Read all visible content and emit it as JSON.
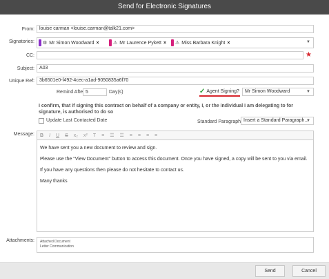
{
  "dialog": {
    "title": "Send for Electronic Signatures"
  },
  "from": {
    "label": "From:",
    "value": "louise carman <louise.carman@talk21.com>"
  },
  "signatories": {
    "label": "Signatories:",
    "items": [
      {
        "name": "Mr Simon Woodward",
        "color": "#8b2fc9",
        "icon": "gear-icon",
        "remove": "×"
      },
      {
        "name": "Mr Laurence Pykett",
        "color": "#d61f7c",
        "icon": "warning-icon",
        "remove": "×"
      },
      {
        "name": "Miss Barbara Knight",
        "color": "#d61f7c",
        "icon": "warning-icon",
        "remove": "×"
      }
    ]
  },
  "cc": {
    "label": "CC:",
    "value": ""
  },
  "subject": {
    "label": "Subject:",
    "value": "A03"
  },
  "unique_ref": {
    "label": "Unique Ref:",
    "value": "3b6501e0-f492-4cec-a1ad-9050835a6f70"
  },
  "remind": {
    "label": "Remind After",
    "value": "5",
    "unit": "Day(s)"
  },
  "agent_signing": {
    "label": "Agent Signing?",
    "checked": true,
    "selected": "Mr Simon Woodward"
  },
  "confirm_text": "I confirm, that if signing this contract on behalf of a company or entity, I, or the individual I am delegating to for signature, is authorised to do so",
  "update_last_contacted": {
    "label": "Update Last Contacted Date",
    "checked": false
  },
  "standard_paragraphs": {
    "label": "Standard Paragraphs",
    "selected": "Insert a Standard Paragraph..."
  },
  "message": {
    "label": "Message:",
    "toolbar": [
      "B",
      "I",
      "U",
      "S",
      "x₂",
      "x²",
      "T",
      "≡",
      "☰",
      "☰",
      "≡",
      "≡",
      "≡",
      "≡"
    ],
    "paragraphs": [
      "We have sent you a new document to review and sign.",
      "Please use the \"View Document\" button to access this document. Once you have signed, a copy will be sent to you via email.",
      "If you have any questions then please do not hesitate to contact us.",
      "Many thanks"
    ]
  },
  "attachments": {
    "label": "Attachments:",
    "items": [
      "Attached Document",
      "Letter Communication"
    ]
  },
  "buttons": {
    "send": "Send",
    "cancel": "Cancel"
  },
  "colors": {
    "titlebar": "#4a4a4a",
    "required": "#d7262d",
    "agent_underline": "#d7262d",
    "tick": "#2e9d3a"
  }
}
